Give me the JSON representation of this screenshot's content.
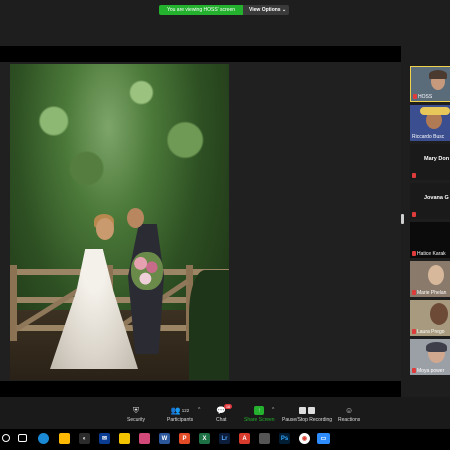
{
  "banner": {
    "message": "You are viewing HOSS' screen",
    "view_options": "View Options ⌄"
  },
  "gallery": {
    "participants": [
      {
        "name": "HOSS",
        "active": true
      },
      {
        "name": "Riccardo Busc"
      },
      {
        "name": "Mary Don",
        "video": false
      },
      {
        "name": "Jovana G",
        "video": false
      },
      {
        "name": "Hatice Karak"
      },
      {
        "name": "Marie Phelan"
      },
      {
        "name": "Laura Prego"
      },
      {
        "name": "Moya power"
      }
    ]
  },
  "toolbar": {
    "security": "Security",
    "participants": "Participants",
    "participants_count": "122",
    "chat": "Chat",
    "chat_badge": "16",
    "share_screen": "Share Screen",
    "pause_recording": "Pause/Stop Recording",
    "reactions": "Reactions"
  },
  "colors": {
    "accent_green": "#23b12e",
    "active_border": "#f0d34a",
    "badge_red": "#e0393e"
  }
}
